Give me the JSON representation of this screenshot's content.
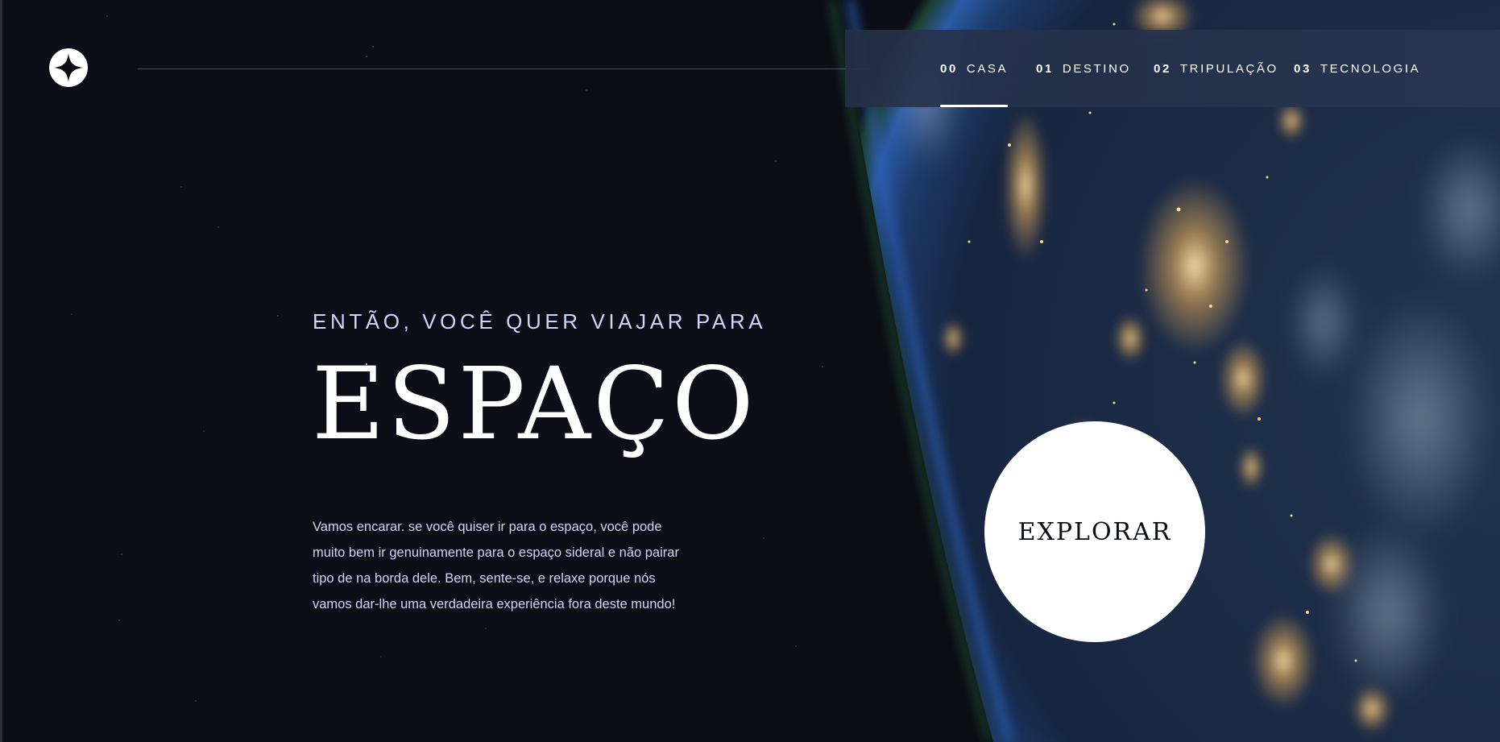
{
  "logo": {
    "icon": "star-logo-icon"
  },
  "nav": {
    "items": [
      {
        "number": "00",
        "label": "CASA",
        "active": true
      },
      {
        "number": "01",
        "label": "DESTINO",
        "active": false
      },
      {
        "number": "02",
        "label": "TRIPULAÇÃO",
        "active": false
      },
      {
        "number": "03",
        "label": "TECNOLOGIA",
        "active": false
      }
    ]
  },
  "hero": {
    "eyebrow": "ENTÃO, VOCÊ QUER VIAJAR PARA",
    "title": "ESPAÇO",
    "description": "Vamos encarar. se você quiser ir para o espaço, você pode muito bem ir genuinamente para o espaço sideral e não pairar tipo de na borda dele. Bem, sente-se, e relaxe porque nós vamos dar-lhe uma verdadeira experiência fora deste mundo!"
  },
  "explore_button": {
    "label": "EXPLORAR"
  },
  "colors": {
    "background": "#0b0d17",
    "accent_text": "#d0d6f9",
    "white": "#ffffff"
  }
}
